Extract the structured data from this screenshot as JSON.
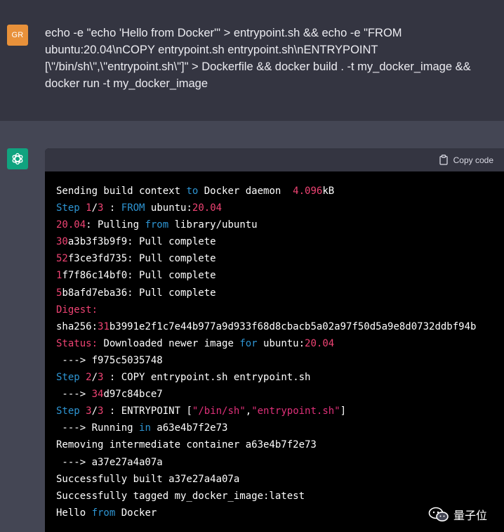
{
  "user": {
    "avatar_initials": "GR",
    "message_lines": [
      "echo -e \"echo 'Hello from Docker'\" > entrypoint.sh && echo -e \"FROM",
      "ubuntu:20.04\\nCOPY entrypoint.sh entrypoint.sh\\nENTRYPOINT",
      "[\\\"/bin/sh\\\",\\\"entrypoint.sh\\\"]\" > Dockerfile && docker build . -t my_docker_image &&",
      "docker run -t my_docker_image"
    ]
  },
  "assistant": {
    "avatar_icon": "openai-logo-icon",
    "copy_label": "Copy code",
    "code_lines": [
      [
        [
          "w",
          "Sending build context "
        ],
        [
          "b",
          "to"
        ],
        [
          "w",
          " Docker daemon  "
        ],
        [
          "r",
          "4.096"
        ],
        [
          "w",
          "kB"
        ]
      ],
      [
        [
          "b",
          "Step "
        ],
        [
          "r",
          "1"
        ],
        [
          "w",
          "/"
        ],
        [
          "r",
          "3"
        ],
        [
          "w",
          " : "
        ],
        [
          "b",
          "FROM"
        ],
        [
          "w",
          " ubuntu:"
        ],
        [
          "r",
          "20.04"
        ]
      ],
      [
        [
          "r",
          "20.04"
        ],
        [
          "w",
          ": Pulling "
        ],
        [
          "b",
          "from"
        ],
        [
          "w",
          " library/ubuntu"
        ]
      ],
      [
        [
          "r",
          "30"
        ],
        [
          "w",
          "a3b3f3b9f9: Pull complete"
        ]
      ],
      [
        [
          "r",
          "52"
        ],
        [
          "w",
          "f3ce3fd735: Pull complete"
        ]
      ],
      [
        [
          "r",
          "1"
        ],
        [
          "w",
          "f7f86c14bf0: Pull complete"
        ]
      ],
      [
        [
          "r",
          "5"
        ],
        [
          "w",
          "b8afd7eba36: Pull complete"
        ]
      ],
      [
        [
          "r",
          "Digest:"
        ]
      ],
      [
        [
          "w",
          "sha256:"
        ],
        [
          "r",
          "31"
        ],
        [
          "w",
          "b3991e2f1c7e44b977a9d933f68d8cbacb5a02a97f50d5a9e8d0732ddbf94b"
        ]
      ],
      [
        [
          "r",
          "Status:"
        ],
        [
          "w",
          " Downloaded newer image "
        ],
        [
          "b",
          "for"
        ],
        [
          "w",
          " ubuntu:"
        ],
        [
          "r",
          "20.04"
        ]
      ],
      [
        [
          "w",
          " ---> f975c5035748"
        ]
      ],
      [
        [
          "b",
          "Step "
        ],
        [
          "r",
          "2"
        ],
        [
          "w",
          "/"
        ],
        [
          "r",
          "3"
        ],
        [
          "w",
          " : COPY entrypoint.sh entrypoint.sh"
        ]
      ],
      [
        [
          "w",
          " ---> "
        ],
        [
          "r",
          "34"
        ],
        [
          "w",
          "d97c84bce7"
        ]
      ],
      [
        [
          "b",
          "Step "
        ],
        [
          "r",
          "3"
        ],
        [
          "w",
          "/"
        ],
        [
          "r",
          "3"
        ],
        [
          "w",
          " : ENTRYPOINT ["
        ],
        [
          "g",
          "\"/bin/sh\""
        ],
        [
          "w",
          ","
        ],
        [
          "g",
          "\"entrypoint.sh\""
        ],
        [
          "w",
          "]"
        ]
      ],
      [
        [
          "w",
          " ---> Running "
        ],
        [
          "b",
          "in"
        ],
        [
          "w",
          " a63e4b7f2e73"
        ]
      ],
      [
        [
          "w",
          "Removing intermediate container a63e4b7f2e73"
        ]
      ],
      [
        [
          "w",
          " ---> a37e27a4a07a"
        ]
      ],
      [
        [
          "w",
          "Successfully built a37e27a4a07a"
        ]
      ],
      [
        [
          "w",
          "Successfully tagged my_docker_image:latest"
        ]
      ],
      [
        [
          "w",
          "Hello "
        ],
        [
          "b",
          "from"
        ],
        [
          "w",
          " Docker"
        ]
      ]
    ]
  },
  "watermark": {
    "text": "量子位",
    "icon": "wechat-icon"
  },
  "colors": {
    "user_bg": "#343541",
    "assistant_bg": "#444654",
    "user_avatar": "#e8913a",
    "assistant_avatar": "#10a37f",
    "code_bg": "#000000",
    "code_header_bg": "#343541",
    "token_number": "#ef4373",
    "token_keyword": "#2e95d3",
    "token_string": "#df3079"
  }
}
